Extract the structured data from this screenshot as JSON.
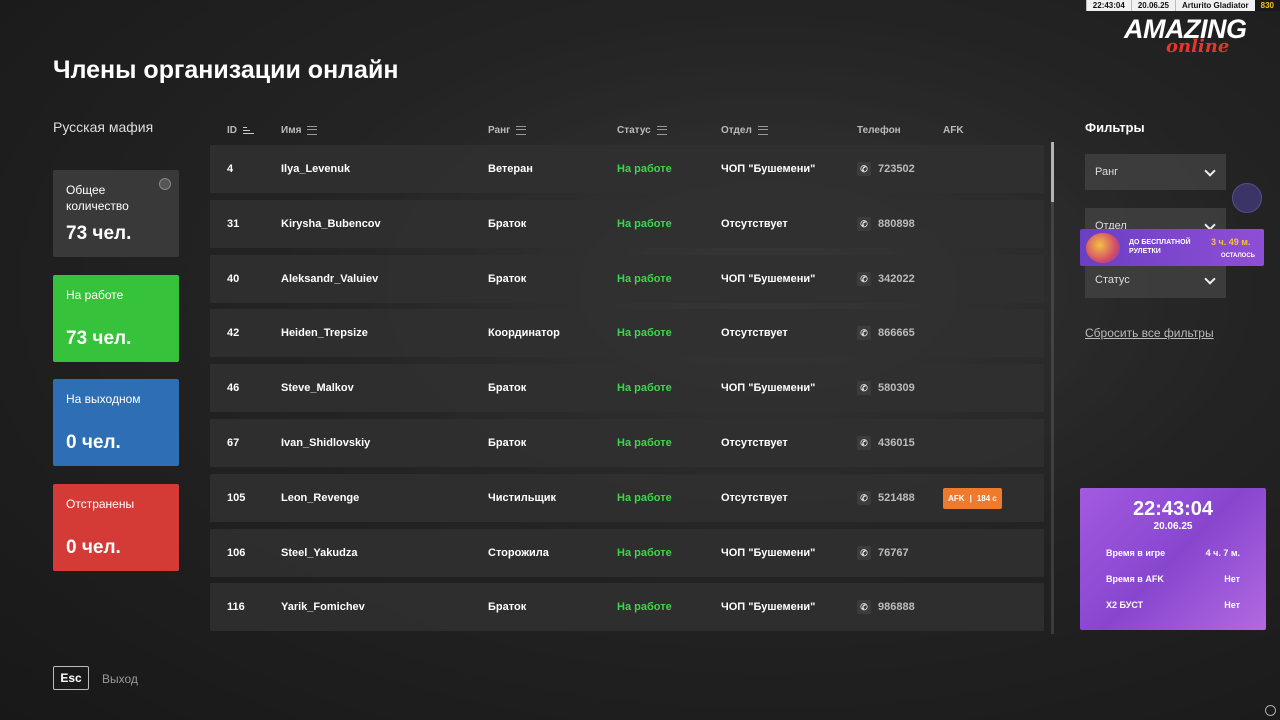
{
  "topbar": {
    "time": "22:43:04",
    "date": "20.06.25",
    "nickname": "Arturito Gladiator",
    "level": "830"
  },
  "logo": {
    "main": "AMAZING",
    "sub": "online"
  },
  "page": {
    "title": "Члены организации онлайн"
  },
  "organization": {
    "name": "Русская мафия"
  },
  "stats": {
    "total": {
      "label": "Общее количество",
      "value": "73 чел."
    },
    "at_work": {
      "label": "На работе",
      "value": "73 чел."
    },
    "day_off": {
      "label": "На выходном",
      "value": "0 чел."
    },
    "suspended": {
      "label": "Отстранены",
      "value": "0 чел."
    }
  },
  "table": {
    "headers": {
      "id": "ID",
      "name": "Имя",
      "rank": "Ранг",
      "status": "Статус",
      "dept": "Отдел",
      "phone": "Телефон",
      "afk": "AFK"
    },
    "rows": [
      {
        "id": "4",
        "name": "Ilya_Levenuk",
        "rank": "Ветеран",
        "status": "На работе",
        "dept": "ЧОП \"Бушемени\"",
        "phone": "723502",
        "afk": ""
      },
      {
        "id": "31",
        "name": "Kirysha_Bubencov",
        "rank": "Браток",
        "status": "На работе",
        "dept": "Отсутствует",
        "phone": "880898",
        "afk": ""
      },
      {
        "id": "40",
        "name": "Aleksandr_Valuiev",
        "rank": "Браток",
        "status": "На работе",
        "dept": "ЧОП \"Бушемени\"",
        "phone": "342022",
        "afk": ""
      },
      {
        "id": "42",
        "name": "Heiden_Trepsize",
        "rank": "Координатор",
        "status": "На работе",
        "dept": "Отсутствует",
        "phone": "866665",
        "afk": ""
      },
      {
        "id": "46",
        "name": "Steve_Malkov",
        "rank": "Браток",
        "status": "На работе",
        "dept": "ЧОП \"Бушемени\"",
        "phone": "580309",
        "afk": ""
      },
      {
        "id": "67",
        "name": "Ivan_Shidlovskiy",
        "rank": "Браток",
        "status": "На работе",
        "dept": "Отсутствует",
        "phone": "436015",
        "afk": ""
      },
      {
        "id": "105",
        "name": "Leon_Revenge",
        "rank": "Чистильщик",
        "status": "На работе",
        "dept": "Отсутствует",
        "phone": "521488",
        "afk": "184 с"
      },
      {
        "id": "106",
        "name": "Steel_Yakudza",
        "rank": "Сторожила",
        "status": "На работе",
        "dept": "ЧОП \"Бушемени\"",
        "phone": "76767",
        "afk": ""
      },
      {
        "id": "116",
        "name": "Yarik_Fomichev",
        "rank": "Браток",
        "status": "На работе",
        "dept": "ЧОП \"Бушемени\"",
        "phone": "986888",
        "afk": ""
      }
    ],
    "afk_badge_label": "AFK"
  },
  "filters": {
    "title": "Фильтры",
    "rank_label": "Ранг",
    "dept_label": "Отдел",
    "status_label": "Статус",
    "reset_label": "Сбросить все фильтры"
  },
  "promo": {
    "text": "ДО БЕСПЛАТНОЙ РУЛЕТКИ",
    "time": "3 ч. 49 м.",
    "left": "ОСТАЛОСЬ"
  },
  "clock": {
    "time": "22:43:04",
    "date": "20.06.25",
    "rows": [
      {
        "label": "Время в игре",
        "value": "4 ч. 7 м."
      },
      {
        "label": "Время в AFK",
        "value": "Нет"
      },
      {
        "label": "X2 БУСТ",
        "value": "Нет"
      }
    ]
  },
  "footer": {
    "esc_key": "Esc",
    "exit_label": "Выход"
  }
}
